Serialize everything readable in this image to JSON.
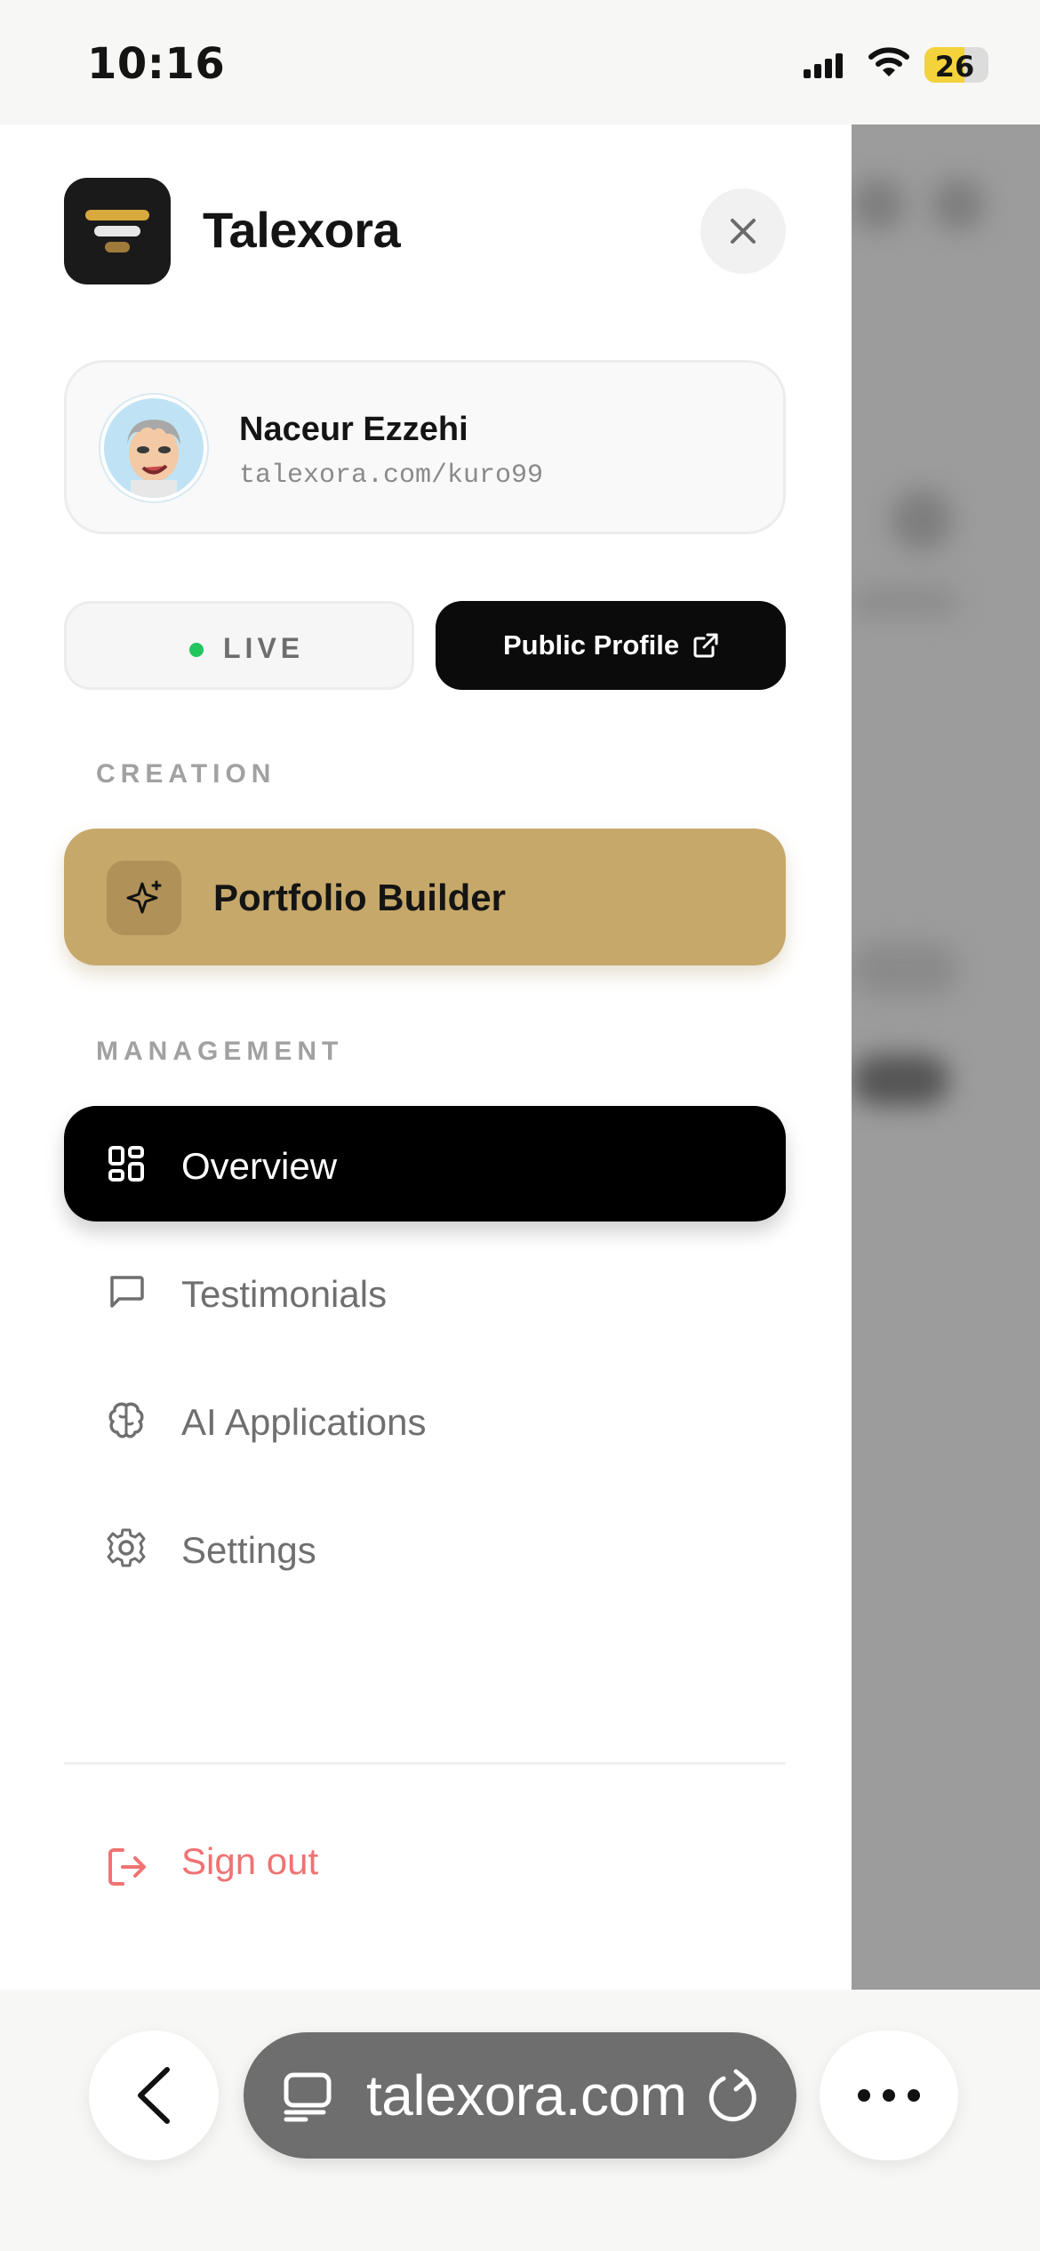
{
  "status_bar": {
    "time": "10:16",
    "battery_level": "26",
    "icons": [
      "cellular-signal-icon",
      "wifi-icon",
      "battery-icon"
    ]
  },
  "drawer": {
    "brand": "Talexora",
    "profile": {
      "name": "Naceur Ezzehi",
      "url": "talexora.com/kuro99"
    },
    "live_label": "LIVE",
    "public_profile_label": "Public Profile",
    "sections": {
      "creation": "CREATION",
      "management": "MANAGEMENT"
    },
    "portfolio_builder": "Portfolio Builder",
    "nav": [
      {
        "label": "Overview",
        "icon": "grid-icon",
        "active": true
      },
      {
        "label": "Testimonials",
        "icon": "message-icon",
        "active": false
      },
      {
        "label": "AI Applications",
        "icon": "brain-icon",
        "active": false
      },
      {
        "label": "Settings",
        "icon": "gear-icon",
        "active": false
      }
    ],
    "sign_out": "Sign out"
  },
  "browser": {
    "url": "talexora.com"
  },
  "colors": {
    "accent_gold": "#c6a86a",
    "live_green": "#22c55e",
    "sign_out_red": "#ef7373",
    "active_nav": "#000000"
  }
}
